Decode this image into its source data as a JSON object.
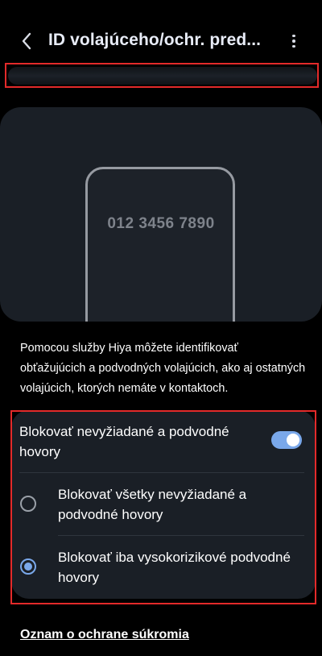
{
  "header": {
    "title": "ID volajúceho/ochr. pred...",
    "back_icon": "chevron-left-icon",
    "more_icon": "more-vertical-icon"
  },
  "preview": {
    "phone_number": "012 3456 7890"
  },
  "description": "Pomocou služby Hiya môžete identifikovať obťažujúcich a podvodných volajúcich, ako aj ostatných volajúcich, ktorých nemáte v kontaktoch.",
  "settings": {
    "block_toggle_label": "Blokovať nevyžiadané a podvodné hovory",
    "block_toggle_on": true,
    "options": [
      {
        "label": "Blokovať všetky nevyžiadané a podvodné hovory",
        "selected": false
      },
      {
        "label": "Blokovať iba vysokorizikové podvodné hovory",
        "selected": true
      }
    ]
  },
  "footer": {
    "privacy_link": "Oznam o ochrane súkromia"
  },
  "colors": {
    "accent": "#7aa8ea",
    "background": "#000000",
    "card": "#1a1f26",
    "highlight_box": "#e32a2a"
  }
}
